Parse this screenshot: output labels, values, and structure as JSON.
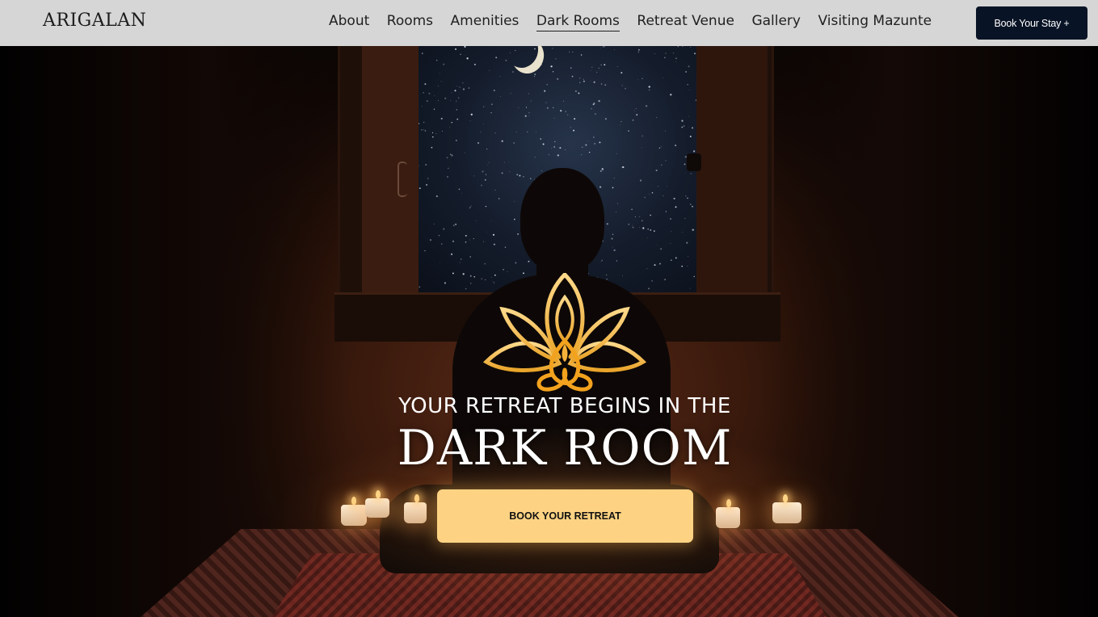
{
  "nav": {
    "brand": "ARIGALAN",
    "links": [
      {
        "label": "About"
      },
      {
        "label": "Rooms"
      },
      {
        "label": "Amenities"
      },
      {
        "label": "Dark Rooms",
        "active": true
      },
      {
        "label": "Retreat Venue"
      },
      {
        "label": "Gallery"
      },
      {
        "label": "Visiting Mazunte"
      }
    ],
    "cta_label": "Book Your Stay +"
  },
  "hero": {
    "logo_icon": "lotus-meditation-icon",
    "headline_small": "YOUR RETREAT BEGINS IN THE",
    "headline_big": "DARK ROOM",
    "cta_label": "BOOK YOUR RETREAT"
  },
  "colors": {
    "nav_bg": "#d6d6d6",
    "nav_button_bg": "#081325",
    "cta_bg": "#fdd383",
    "logo_gold": "#f3b840"
  }
}
